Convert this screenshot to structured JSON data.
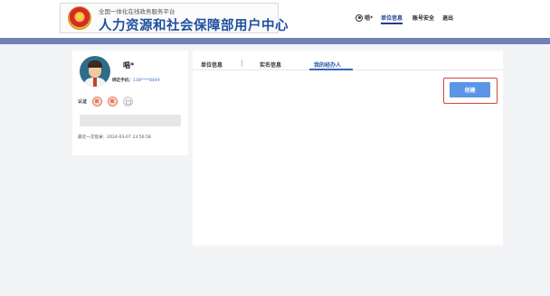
{
  "header": {
    "subtitle": "全国一体化在线政务服务平台",
    "title": "人力资源和社会保障部用户中心",
    "user_name": "唱*",
    "nav": [
      "单位信息",
      "账号安全",
      "退出"
    ]
  },
  "profile": {
    "name": "唱*",
    "phone_label": "绑定手机：",
    "phone_value": "138****8449",
    "cert_label": "认证",
    "disabled_button": "",
    "last_login": "最近一次登录：2024-03-07 23:56:58"
  },
  "main": {
    "tabs": [
      "单位信息",
      "实名信息",
      "我的经办人"
    ],
    "active_tab": 2,
    "create_button": "创建"
  },
  "colors": {
    "brand_blue": "#1f4f9f",
    "band": "#6f82b4",
    "create_button": "#5c95e8",
    "highlight_border": "#d6453a"
  }
}
